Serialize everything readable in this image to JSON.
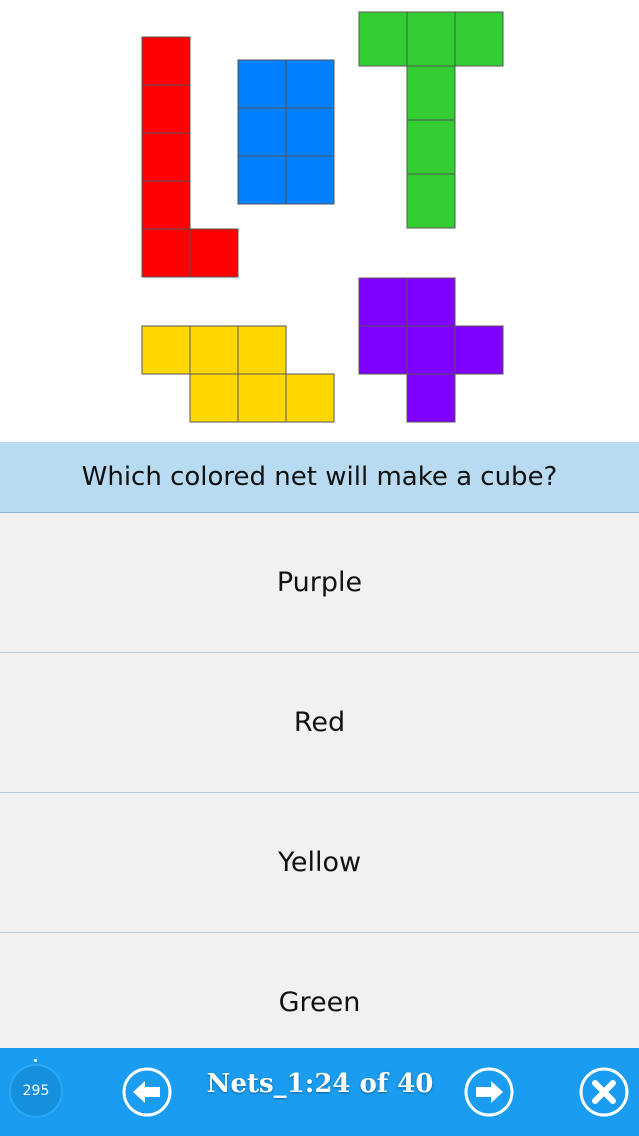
{
  "question": {
    "text": "Which colored net will make a cube?"
  },
  "nets": [
    {
      "name": "red",
      "color": "#ff0000"
    },
    {
      "name": "blue",
      "color": "#0080ff"
    },
    {
      "name": "green",
      "color": "#33cc33"
    },
    {
      "name": "yellow",
      "color": "#ffd700"
    },
    {
      "name": "purple",
      "color": "#8000ff"
    }
  ],
  "answers": [
    {
      "label": "Purple"
    },
    {
      "label": "Red"
    },
    {
      "label": "Yellow"
    },
    {
      "label": "Green"
    }
  ],
  "footer": {
    "score": "295",
    "progress": "Nets_1:24 of 40",
    "prev_icon": "arrow-left-icon",
    "next_icon": "arrow-right-icon",
    "close_icon": "close-icon"
  }
}
